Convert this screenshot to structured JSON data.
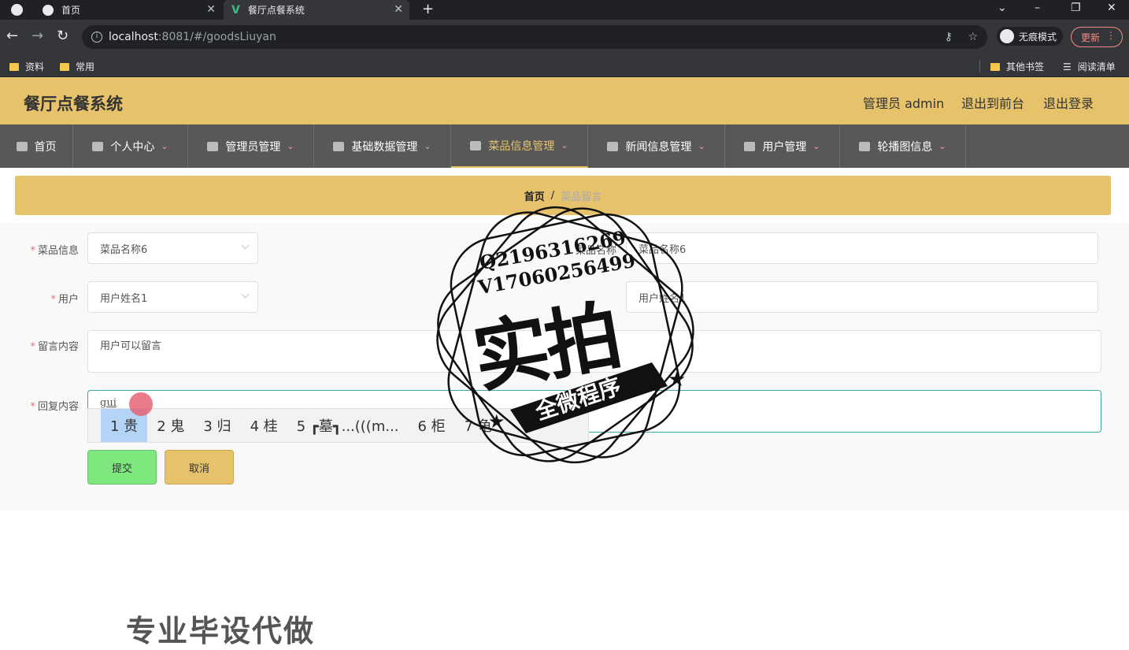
{
  "browser": {
    "tabs": [
      {
        "title": "首页"
      },
      {
        "title": "餐厅点餐系统"
      }
    ],
    "new_tab": "+",
    "url_host": "localhost",
    "url_path": ":8081/#/goodsLiuyan",
    "incognito_label": "无痕模式",
    "update_label": "更新",
    "bookmarks": [
      {
        "label": "资料"
      },
      {
        "label": "常用"
      }
    ],
    "other_bookmarks": "其他书签",
    "reading_list": "阅读清单"
  },
  "app": {
    "title": "餐厅点餐系统",
    "admin_label": "管理员 admin",
    "back_front": "退出到前台",
    "logout": "退出登录"
  },
  "nav": [
    {
      "label": "首页",
      "icon": "home-icon"
    },
    {
      "label": "个人中心",
      "icon": "user-icon"
    },
    {
      "label": "管理员管理",
      "icon": "briefcase-icon"
    },
    {
      "label": "基础数据管理",
      "icon": "user-icon"
    },
    {
      "label": "菜品信息管理",
      "icon": "dashboard-icon"
    },
    {
      "label": "新闻信息管理",
      "icon": "mic-icon"
    },
    {
      "label": "用户管理",
      "icon": "power-icon"
    },
    {
      "label": "轮播图信息",
      "icon": "chart-icon"
    }
  ],
  "breadcrumb": {
    "home": "首页",
    "sep": "/",
    "current": "菜品留言"
  },
  "form": {
    "dish_label": "菜品信息",
    "dish_value": "菜品名称6",
    "dish_name_label": "菜品名称",
    "dish_name_value": "菜品名称6",
    "user_label": "用户",
    "user_value": "用户姓名1",
    "user_name_value": "用户姓名1",
    "message_label": "留言内容",
    "message_value": "用户可以留言",
    "reply_label": "回复内容",
    "reply_value": "gui",
    "submit": "提交",
    "cancel": "取消"
  },
  "ime": {
    "candidates": [
      "1 贵",
      "2 鬼",
      "3 归",
      "4 桂",
      "5 ┏墓┓...(((m...",
      "6 柜",
      "7 龟"
    ]
  },
  "watermark": {
    "line1": "Q2196316269",
    "line2": "V17060256499",
    "big": "实拍",
    "ribbon": "全微程序",
    "bottom": "专业毕设代做"
  }
}
